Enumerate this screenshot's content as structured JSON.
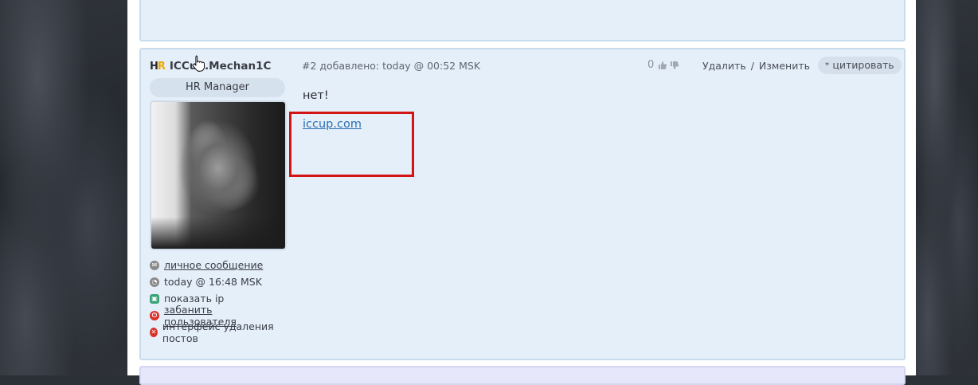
{
  "post": {
    "author": {
      "logo_h": "H",
      "logo_r": "R",
      "name": "ICCup.Mechan1C",
      "role": "HR Manager"
    },
    "meta": "#2 добавлено: today @ 00:52 MSK",
    "rating": "0",
    "actions": {
      "delete": "Удалить",
      "separator": "/",
      "edit": "Изменить",
      "quote": "цитировать",
      "quote_glyph": "❞"
    },
    "body": {
      "text": "нет!",
      "link": "iccup.com"
    },
    "user_links": [
      {
        "label": "личное сообщение",
        "icon": "mail-icon"
      },
      {
        "label": "today @ 16:48 MSK",
        "icon": "clock-icon"
      },
      {
        "label": "показать ip",
        "icon": "ip-icon"
      },
      {
        "label": "забанить пользователя",
        "icon": "ban-icon"
      },
      {
        "label": "интерфейс удаления постов",
        "icon": "delete-icon"
      }
    ]
  },
  "colors": {
    "accent_link": "#2a6fb0",
    "highlight_box": "#d21414",
    "ban_red": "#d9322b"
  }
}
